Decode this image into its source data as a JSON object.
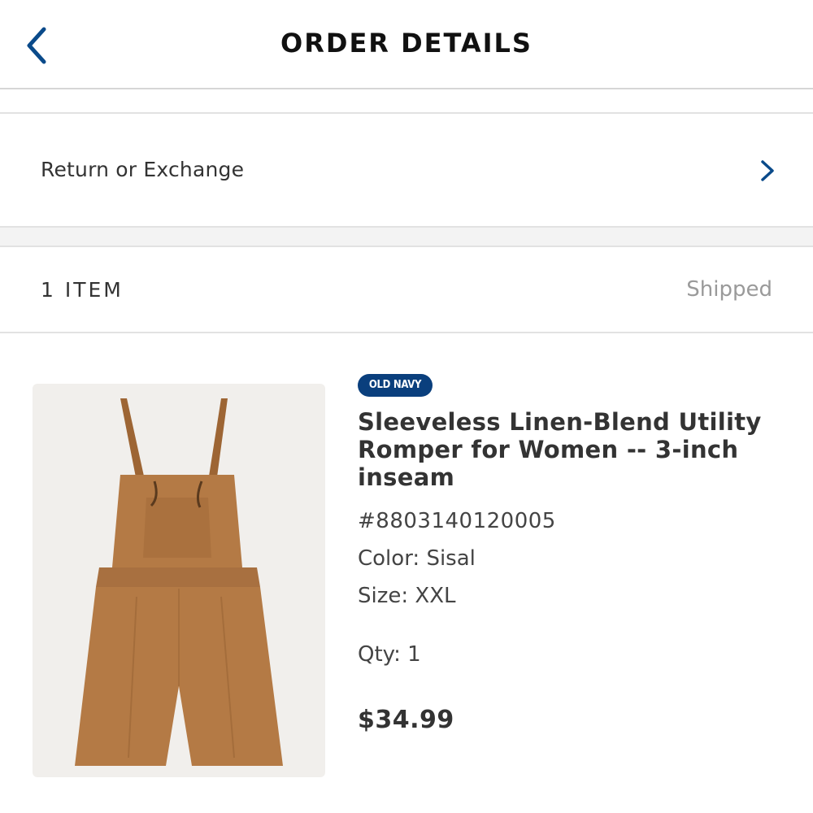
{
  "header": {
    "title": "ORDER DETAILS",
    "back_icon": "chevron-left-icon"
  },
  "return_row": {
    "label": "Return or Exchange",
    "chevron_icon": "chevron-right-icon"
  },
  "items_header": {
    "count_label": "1 ITEM",
    "status": "Shipped"
  },
  "product": {
    "brand": "OLD NAVY",
    "name": "Sleeveless Linen-Blend Utility Romper for Women -- 3-inch inseam",
    "sku": "#8803140120005",
    "color": "Color: Sisal",
    "size": "Size: XXL",
    "qty": "Qty: 1",
    "price": "$34.99"
  },
  "colors": {
    "accent": "#0a3f7d",
    "product_fill": "#b47a45"
  }
}
